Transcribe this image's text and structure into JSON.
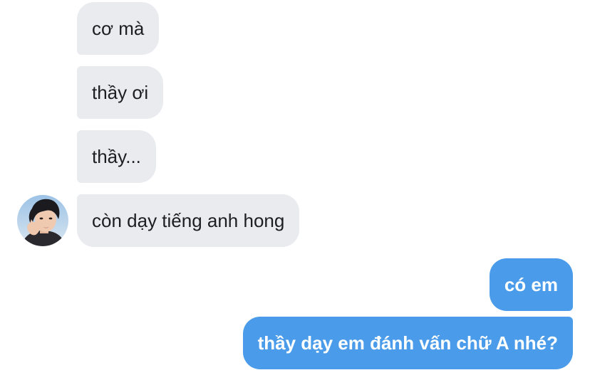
{
  "conversation": {
    "incoming_messages": [
      {
        "text": "cơ mà"
      },
      {
        "text": "thầy ơi"
      },
      {
        "text": "thầy..."
      },
      {
        "text": "còn dạy tiếng anh hong"
      }
    ],
    "outgoing_messages": [
      {
        "text": "có em"
      },
      {
        "text": "thầy dạy em đánh vấn chữ A nhé?"
      }
    ]
  },
  "sender": {
    "avatar_icon": "user-avatar-photo"
  },
  "colors": {
    "incoming_bubble": "#e9ebef",
    "outgoing_bubble": "#4a9ceb",
    "incoming_text": "#1c1e21",
    "outgoing_text": "#ffffff"
  }
}
